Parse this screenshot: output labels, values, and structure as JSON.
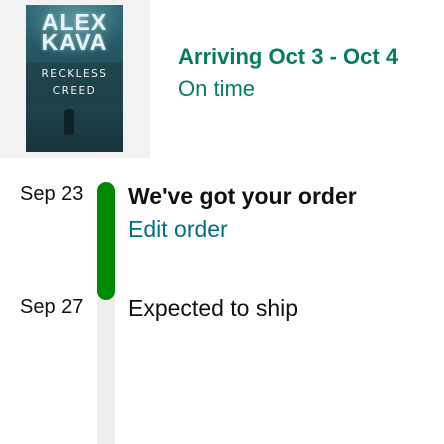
{
  "product": {
    "cover": {
      "author": "ALEX KAVA",
      "title_line_1": "RECKLESS",
      "title_line_2": "CREED"
    }
  },
  "delivery": {
    "arrival": "Arriving Oct 3 - Oct 4",
    "status": "On time"
  },
  "timeline": {
    "progress_fraction": 0.5,
    "steps": [
      {
        "date": "Sep 23",
        "title": "We've got your order",
        "action": "Edit order",
        "completed": true
      },
      {
        "date": "Sep 27",
        "title": "Expected to ship",
        "completed": false
      }
    ]
  },
  "colors": {
    "arrival_green": "#067d62",
    "progress_green": "#008a00",
    "link_teal": "#007185",
    "track_gray": "#eeeeee"
  }
}
